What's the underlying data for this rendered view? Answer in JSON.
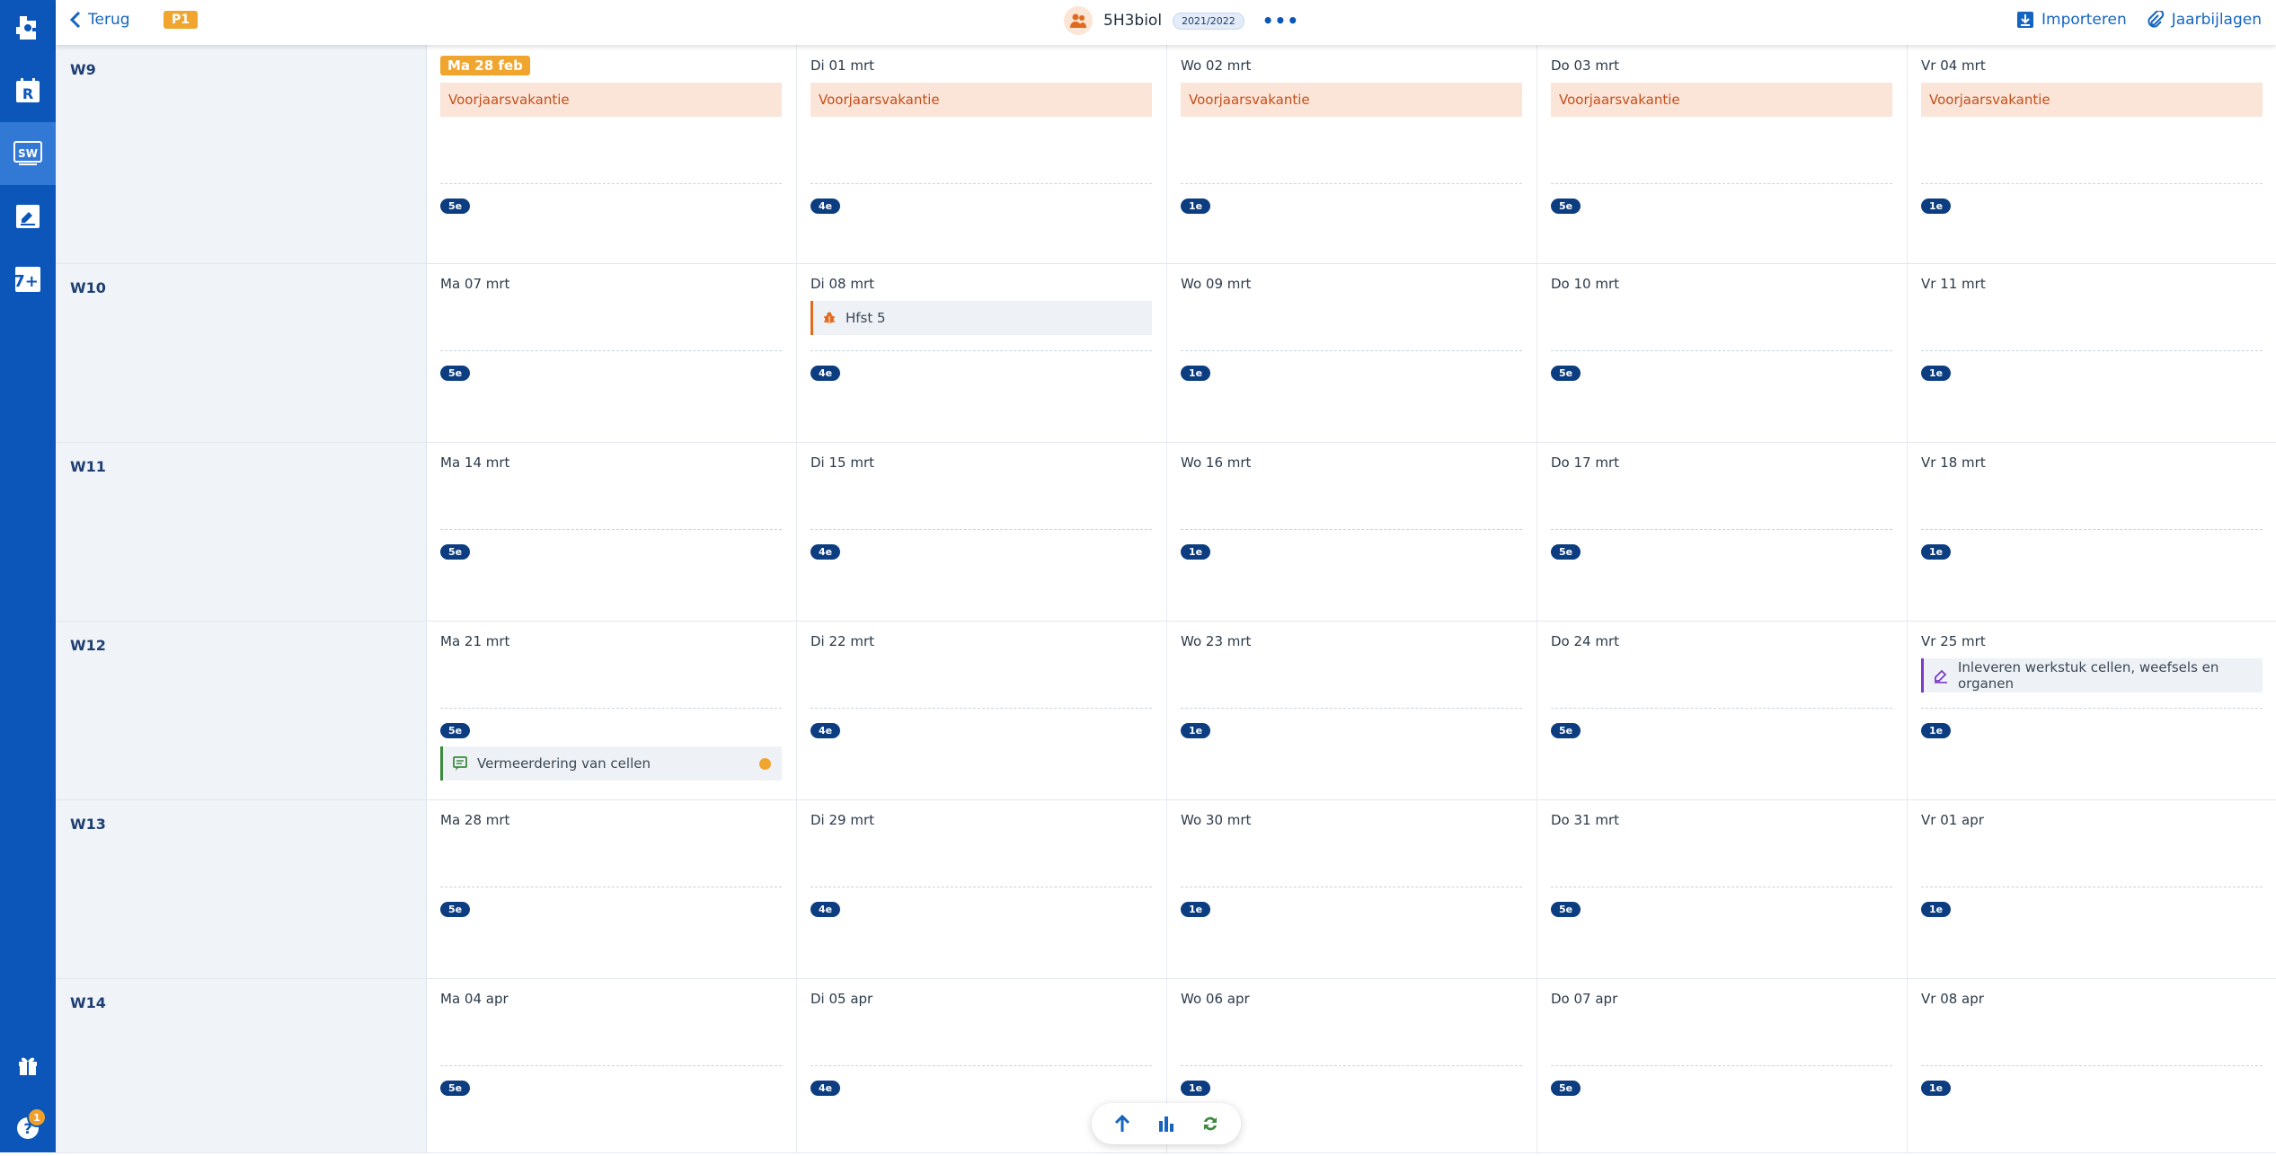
{
  "topbar": {
    "back_label": "Terug",
    "period": "P1",
    "group_name": "5H3biol",
    "school_year": "2021/2022",
    "more_label": "•••",
    "import_label": "Importeren",
    "attachments_label": "Jaarbijlagen"
  },
  "rail": {
    "items": [
      "logo-icon",
      "roster-icon",
      "sw-icon",
      "assignment-icon",
      "grade-icon"
    ],
    "bottom": [
      "gift-icon",
      "help-icon"
    ],
    "help_badge": "1",
    "sw_text": "SW",
    "r_text": "R",
    "seven_text": "7+"
  },
  "colors": {
    "rail": "#0b56b8",
    "accent": "#1565c0",
    "today": "#f0a52f",
    "vacation_bg": "#fbe4d8",
    "vacation_text": "#c4501a",
    "pill": "#0b3d80"
  },
  "weeks": [
    {
      "label": "W9",
      "days": [
        {
          "label": "Ma 28 feb",
          "today": true,
          "vacation": "Voorjaarsvakantie",
          "hour": "5e"
        },
        {
          "label": "Di 01 mrt",
          "vacation": "Voorjaarsvakantie",
          "hour": "4e"
        },
        {
          "label": "Wo 02 mrt",
          "vacation": "Voorjaarsvakantie",
          "hour": "1e"
        },
        {
          "label": "Do 03 mrt",
          "vacation": "Voorjaarsvakantie",
          "hour": "5e"
        },
        {
          "label": "Vr 04 mrt",
          "vacation": "Voorjaarsvakantie",
          "hour": "1e"
        }
      ]
    },
    {
      "label": "W10",
      "days": [
        {
          "label": "Ma 07 mrt",
          "hour": "5e"
        },
        {
          "label": "Di 08 mrt",
          "hour": "4e",
          "event": {
            "title": "Hfst 5",
            "type": "orange",
            "icon": "bug-icon"
          }
        },
        {
          "label": "Wo 09 mrt",
          "hour": "1e"
        },
        {
          "label": "Do 10 mrt",
          "hour": "5e"
        },
        {
          "label": "Vr 11 mrt",
          "hour": "1e"
        }
      ]
    },
    {
      "label": "W11",
      "days": [
        {
          "label": "Ma 14 mrt",
          "hour": "5e"
        },
        {
          "label": "Di 15 mrt",
          "hour": "4e"
        },
        {
          "label": "Wo 16 mrt",
          "hour": "1e"
        },
        {
          "label": "Do 17 mrt",
          "hour": "5e"
        },
        {
          "label": "Vr 18 mrt",
          "hour": "1e"
        }
      ]
    },
    {
      "label": "W12",
      "days": [
        {
          "label": "Ma 21 mrt",
          "hour": "5e",
          "after_event": {
            "title": "Vermeerdering van cellen",
            "type": "green",
            "icon": "chat-icon",
            "dot": true
          }
        },
        {
          "label": "Di 22 mrt",
          "hour": "4e"
        },
        {
          "label": "Wo 23 mrt",
          "hour": "1e"
        },
        {
          "label": "Do 24 mrt",
          "hour": "5e"
        },
        {
          "label": "Vr 25 mrt",
          "hour": "1e",
          "event": {
            "title": "Inleveren werkstuk cellen, weefsels en organen",
            "type": "purple",
            "icon": "edit-icon"
          }
        }
      ]
    },
    {
      "label": "W13",
      "days": [
        {
          "label": "Ma 28 mrt",
          "hour": "5e"
        },
        {
          "label": "Di 29 mrt",
          "hour": "4e"
        },
        {
          "label": "Wo 30 mrt",
          "hour": "1e"
        },
        {
          "label": "Do 31 mrt",
          "hour": "5e"
        },
        {
          "label": "Vr 01 apr",
          "hour": "1e"
        }
      ]
    },
    {
      "label": "W14",
      "days": [
        {
          "label": "Ma 04 apr",
          "hour": "5e"
        },
        {
          "label": "Di 05 apr",
          "hour": "4e"
        },
        {
          "label": "Wo 06 apr",
          "hour": "1e"
        },
        {
          "label": "Do 07 apr",
          "hour": "5e"
        },
        {
          "label": "Vr 08 apr",
          "hour": "1e"
        }
      ]
    }
  ],
  "float_toolbar": [
    "arrow-up-icon",
    "bar-chart-icon",
    "sync-icon"
  ]
}
